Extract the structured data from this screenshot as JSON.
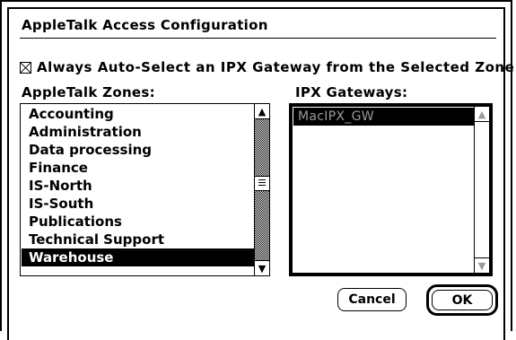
{
  "dialog": {
    "title": "AppleTalk Access Configuration",
    "checkbox_label": "Always Auto-Select an IPX Gateway from the Selected Zone",
    "checkbox_checked": true
  },
  "zones": {
    "label": "AppleTalk Zones:",
    "items": [
      "Accounting",
      "Administration",
      "Data processing",
      "Finance",
      "IS-North",
      "IS-South",
      "Publications",
      "Technical Support",
      "Warehouse"
    ],
    "selected": "Warehouse"
  },
  "gateways": {
    "label": "IPX Gateways:",
    "items": [
      "MacIPX_GW"
    ]
  },
  "buttons": {
    "cancel": "Cancel",
    "ok": "OK"
  },
  "icons": {
    "up": "▲",
    "down": "▼"
  }
}
